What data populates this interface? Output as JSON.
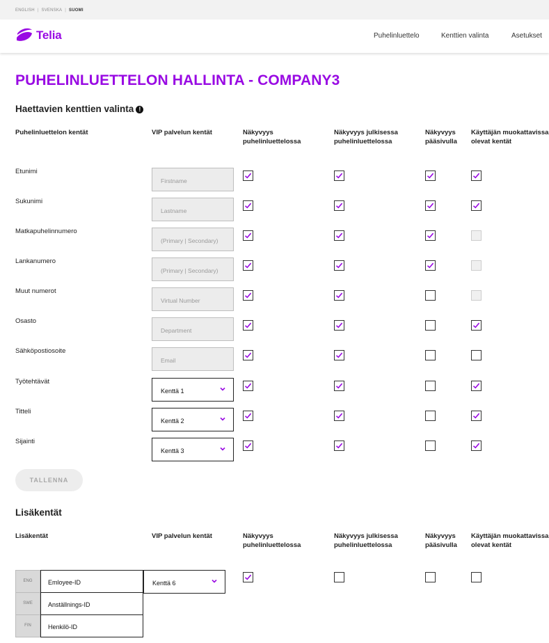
{
  "languages": [
    "ENGLISH",
    "SVENSKA",
    "SUOMI"
  ],
  "active_language": "SUOMI",
  "brand": {
    "name": "Telia",
    "color": "#990ae3"
  },
  "nav": [
    "Puhelinluettelo",
    "Kenttien valinta",
    "Asetukset"
  ],
  "page_title": "PUHELINLUETTELON HALLINTA - COMPANY3",
  "section1": {
    "title": "Haettavien kenttien valinta",
    "info_icon": "!",
    "headers": [
      "Puhelinluettelon kentät",
      "VIP palvelun kentät",
      "Näkyvyys puhelinluettelossa",
      "Näkyvyys julkisessa puhelinluettelossa",
      "Näkyvyys pääsivulla",
      "Käyttäjän muokattavissa olevat kentät"
    ],
    "rows": [
      {
        "label": "Etunimi",
        "vip_type": "input",
        "vip": "Firstname",
        "checks": [
          "checked",
          "checked",
          "checked",
          "checked"
        ]
      },
      {
        "label": "Sukunimi",
        "vip_type": "input",
        "vip": "Lastname",
        "checks": [
          "checked",
          "checked",
          "checked",
          "checked"
        ]
      },
      {
        "label": "Matkapuhelinnumero",
        "vip_type": "input",
        "vip": "(Primary | Secondary)",
        "checks": [
          "checked",
          "checked",
          "checked",
          "disabled"
        ]
      },
      {
        "label": "Lankanumero",
        "vip_type": "input",
        "vip": "(Primary | Secondary)",
        "checks": [
          "checked",
          "checked",
          "checked",
          "disabled"
        ]
      },
      {
        "label": "Muut numerot",
        "vip_type": "input",
        "vip": "Virtual Number",
        "checks": [
          "checked",
          "checked",
          "unchecked",
          "disabled"
        ]
      },
      {
        "label": "Osasto",
        "vip_type": "input",
        "vip": "Department",
        "checks": [
          "checked",
          "checked",
          "unchecked",
          "checked"
        ]
      },
      {
        "label": "Sähköpostiosoite",
        "vip_type": "input",
        "vip": "Email",
        "checks": [
          "checked",
          "checked",
          "unchecked",
          "unchecked"
        ]
      },
      {
        "label": "Työtehtävät",
        "vip_type": "select",
        "vip": "Kenttä 1",
        "checks": [
          "checked",
          "checked",
          "unchecked",
          "checked"
        ]
      },
      {
        "label": "Titteli",
        "vip_type": "select",
        "vip": "Kenttä 2",
        "checks": [
          "checked",
          "checked",
          "unchecked",
          "checked"
        ]
      },
      {
        "label": "Sijainti",
        "vip_type": "select",
        "vip": "Kenttä 3",
        "checks": [
          "checked",
          "checked",
          "unchecked",
          "checked"
        ]
      }
    ]
  },
  "save_label": "TALLENNA",
  "section2": {
    "title": "Lisäkentät",
    "headers": [
      "Lisäkentät",
      "VIP palvelun kentät",
      "Näkyvyys puhelinluettelossa",
      "Näkyvyys julkisessa puhelinluettelossa",
      "Näkyvyys pääsivulla",
      "Käyttäjän muokattavissa olevat kentät"
    ],
    "extra_field": {
      "names": [
        {
          "lang": "ENG",
          "value": "Emloyee-ID"
        },
        {
          "lang": "SWE",
          "value": "Anställnings-ID"
        },
        {
          "lang": "FIN",
          "value": "Henkilö-ID"
        }
      ],
      "vip": "Kenttä 6",
      "checks": [
        "checked",
        "unchecked",
        "unchecked",
        "unchecked"
      ]
    }
  },
  "colors": {
    "accent": "#990ae3",
    "checkmark": "#990ae3"
  }
}
